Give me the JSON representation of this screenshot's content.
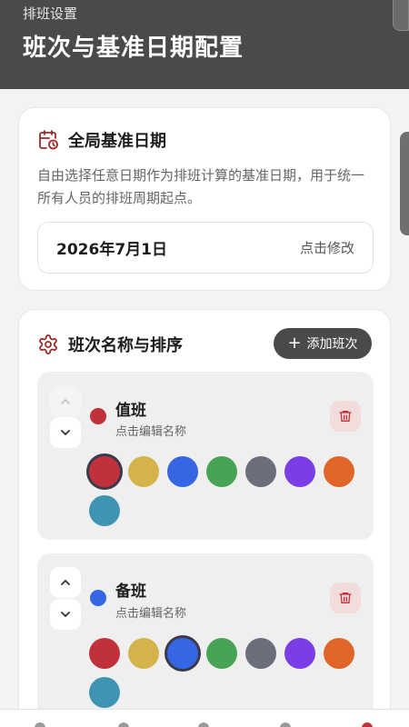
{
  "header": {
    "subtitle": "排班设置",
    "title": "班次与基准日期配置"
  },
  "base_date": {
    "title": "全局基准日期",
    "description": "自由选择任意日期作为排班计算的基准日期，用于统一所有人员的排班周期起点。",
    "date_value": "2026年7月1日",
    "edit_label": "点击修改"
  },
  "shifts_section": {
    "title": "班次名称与排序",
    "add_label": "添加班次",
    "palette": [
      "#c0313b",
      "#d4b44a",
      "#3566e3",
      "#48a455",
      "#6b6f7b",
      "#7a3de6",
      "#e06528",
      "#3f93b3"
    ],
    "items": [
      {
        "name": "值班",
        "hint": "点击编辑名称",
        "color": "#c0313b",
        "selected_index": 0,
        "up_disabled": true
      },
      {
        "name": "备班",
        "hint": "点击编辑名称",
        "color": "#3566e3",
        "selected_index": 2,
        "up_disabled": false
      }
    ]
  },
  "colors": {
    "header_bg": "#4a4a4a",
    "accent_icon": "#9b2b2b",
    "delete_bg": "#f2dcdc"
  }
}
